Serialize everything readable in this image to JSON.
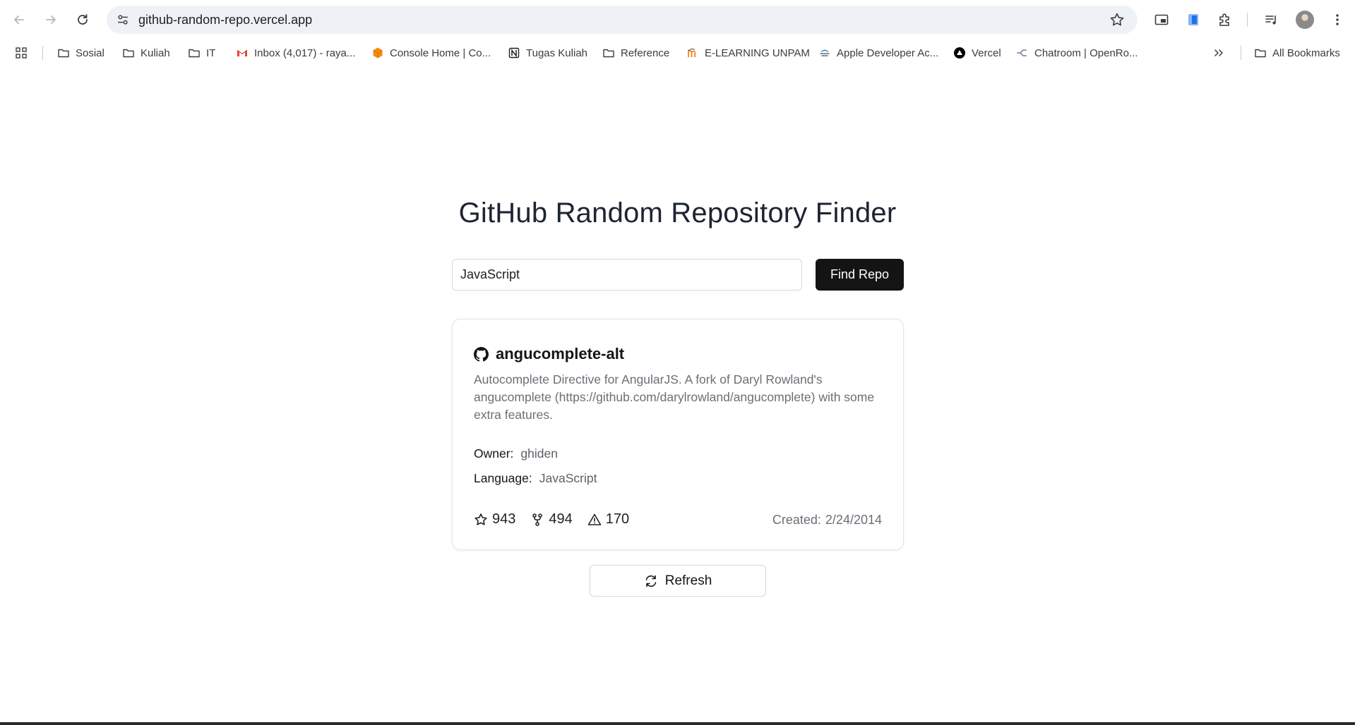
{
  "browser": {
    "url": "github-random-repo.vercel.app"
  },
  "bookmarks": {
    "items": [
      {
        "label": "Sosial",
        "icon": "folder-icon"
      },
      {
        "label": "Kuliah",
        "icon": "folder-icon"
      },
      {
        "label": "IT",
        "icon": "folder-icon"
      },
      {
        "label": "Inbox (4,017) - raya...",
        "icon": "gmail-icon"
      },
      {
        "label": "Console Home | Co...",
        "icon": "cube-icon"
      },
      {
        "label": "Tugas Kuliah",
        "icon": "notion-icon"
      },
      {
        "label": "Reference",
        "icon": "folder-icon"
      },
      {
        "label": "E-LEARNING UNPAM",
        "icon": "moodle-icon"
      },
      {
        "label": "Apple Developer Ac...",
        "icon": "apple-dev-icon"
      },
      {
        "label": "Vercel",
        "icon": "vercel-icon"
      },
      {
        "label": "Chatroom | OpenRo...",
        "icon": "openrouter-icon"
      }
    ],
    "all_bookmarks": "All Bookmarks"
  },
  "page": {
    "title": "GitHub Random Repository Finder",
    "search_value": "JavaScript",
    "find_button": "Find Repo",
    "refresh_button": "Refresh"
  },
  "repo": {
    "name": "angucomplete-alt",
    "description": "Autocomplete Directive for AngularJS. A fork of Daryl Rowland's angucomplete (https://github.com/darylrowland/angucomplete) with some extra features.",
    "owner_label": "Owner:",
    "owner": "ghiden",
    "language_label": "Language:",
    "language": "JavaScript",
    "stars": "943",
    "forks": "494",
    "issues": "170",
    "created_label": "Created:",
    "created": "2/24/2014"
  },
  "colors": {
    "primary_button": "#141414",
    "omnibox_bg": "#eef1f6",
    "title": "#1d2433"
  }
}
